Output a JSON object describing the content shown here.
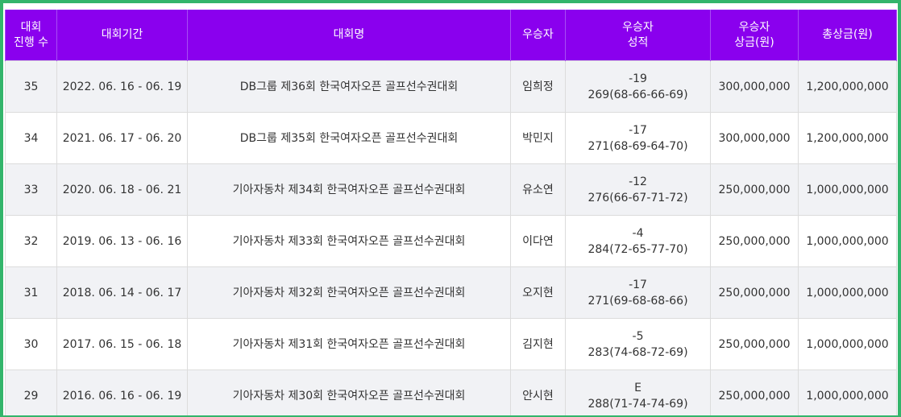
{
  "headers": [
    [
      "대회",
      "진행 수"
    ],
    [
      "대회기간"
    ],
    [
      "대회명"
    ],
    [
      "우승자"
    ],
    [
      "우승자",
      "성적"
    ],
    [
      "우승자",
      "상금(원)"
    ],
    [
      "총상금(원)"
    ]
  ],
  "rows": [
    {
      "round": "35",
      "period": "2022. 06. 16 - 06. 19",
      "name": "DB그룹 제36회 한국여자오픈 골프선수권대회",
      "winner": "임희정",
      "score_rel": "-19",
      "score_total": "269(68-66-66-69)",
      "prize": "300,000,000",
      "purse": "1,200,000,000"
    },
    {
      "round": "34",
      "period": "2021. 06. 17 - 06. 20",
      "name": "DB그룹 제35회 한국여자오픈 골프선수권대회",
      "winner": "박민지",
      "score_rel": "-17",
      "score_total": "271(68-69-64-70)",
      "prize": "300,000,000",
      "purse": "1,200,000,000"
    },
    {
      "round": "33",
      "period": "2020. 06. 18 - 06. 21",
      "name": "기아자동차 제34회 한국여자오픈 골프선수권대회",
      "winner": "유소연",
      "score_rel": "-12",
      "score_total": "276(66-67-71-72)",
      "prize": "250,000,000",
      "purse": "1,000,000,000"
    },
    {
      "round": "32",
      "period": "2019. 06. 13 - 06. 16",
      "name": "기아자동차 제33회 한국여자오픈 골프선수권대회",
      "winner": "이다연",
      "score_rel": "-4",
      "score_total": "284(72-65-77-70)",
      "prize": "250,000,000",
      "purse": "1,000,000,000"
    },
    {
      "round": "31",
      "period": "2018. 06. 14 - 06. 17",
      "name": "기아자동차 제32회 한국여자오픈 골프선수권대회",
      "winner": "오지현",
      "score_rel": "-17",
      "score_total": "271(69-68-68-66)",
      "prize": "250,000,000",
      "purse": "1,000,000,000"
    },
    {
      "round": "30",
      "period": "2017. 06. 15 - 06. 18",
      "name": "기아자동차 제31회 한국여자오픈 골프선수권대회",
      "winner": "김지현",
      "score_rel": "-5",
      "score_total": "283(74-68-72-69)",
      "prize": "250,000,000",
      "purse": "1,000,000,000"
    },
    {
      "round": "29",
      "period": "2016. 06. 16 - 06. 19",
      "name": "기아자동차 제30회 한국여자오픈 골프선수권대회",
      "winner": "안시현",
      "score_rel": "E",
      "score_total": "288(71-74-74-69)",
      "prize": "250,000,000",
      "purse": "1,000,000,000"
    }
  ],
  "colors": {
    "header_bg": "#8a00ee",
    "frame_border": "#33b56b",
    "row_odd_bg": "#f1f2f5",
    "row_even_bg": "#ffffff"
  }
}
